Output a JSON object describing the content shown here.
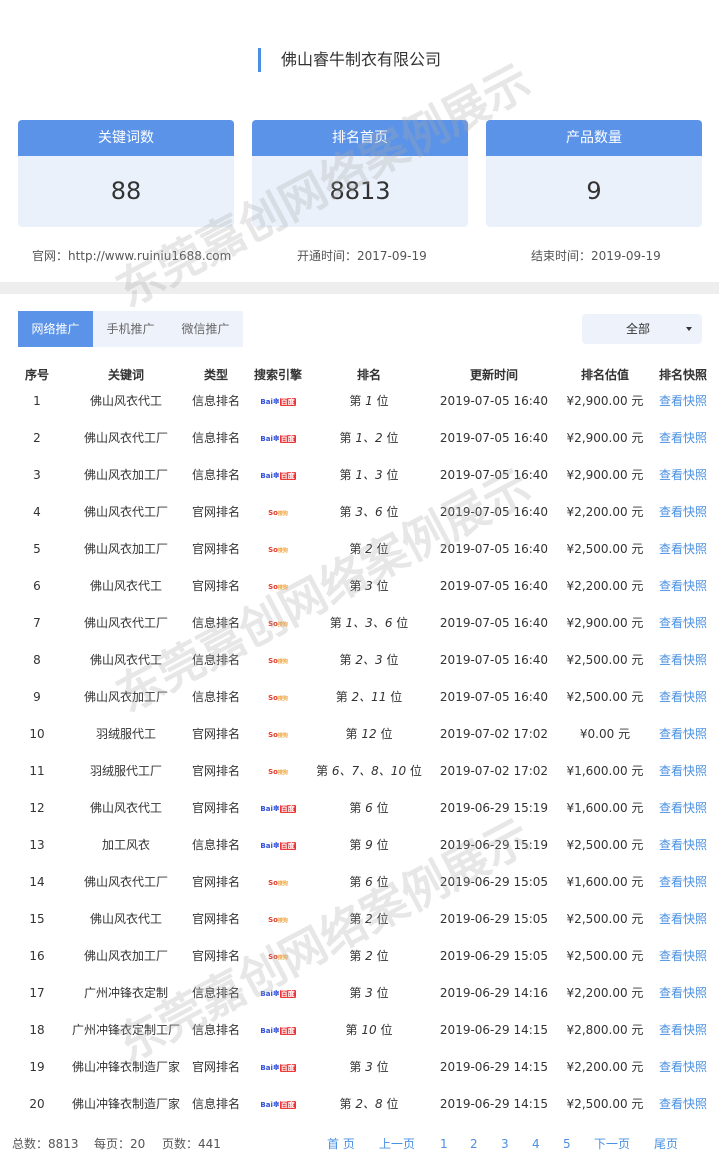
{
  "company": "佛山睿牛制衣有限公司",
  "stats": [
    {
      "label": "关键词数",
      "value": "88"
    },
    {
      "label": "排名首页",
      "value": "8813"
    },
    {
      "label": "产品数量",
      "value": "9"
    }
  ],
  "site_info": {
    "website": "官网：http://www.ruiniu1688.com",
    "open_time": "开通时间：2017-09-19",
    "end_time": "结束时间：2019-09-19"
  },
  "tabs": [
    {
      "label": "网络推广",
      "active": true
    },
    {
      "label": "手机推广",
      "active": false
    },
    {
      "label": "微信推广",
      "active": false
    }
  ],
  "filter": {
    "value": "全部"
  },
  "table": {
    "headers": [
      "序号",
      "关键词",
      "类型",
      "搜索引擎",
      "排名",
      "更新时间",
      "排名估值",
      "排名快照"
    ],
    "rows": [
      {
        "no": "1",
        "keyword": "佛山风衣代工",
        "type": "信息排名",
        "engine": "baidu",
        "rank_pre": "第 ",
        "rank_num": "1",
        "rank_post": " 位",
        "time": "2019-07-05 16:40",
        "value": "¥2,900.00 元",
        "snap": "查看快照"
      },
      {
        "no": "2",
        "keyword": "佛山风衣代工厂",
        "type": "信息排名",
        "engine": "baidu",
        "rank_pre": "第 ",
        "rank_num": "1、2",
        "rank_post": " 位",
        "time": "2019-07-05 16:40",
        "value": "¥2,900.00 元",
        "snap": "查看快照"
      },
      {
        "no": "3",
        "keyword": "佛山风衣加工厂",
        "type": "信息排名",
        "engine": "baidu",
        "rank_pre": "第 ",
        "rank_num": "1、3",
        "rank_post": " 位",
        "time": "2019-07-05 16:40",
        "value": "¥2,900.00 元",
        "snap": "查看快照"
      },
      {
        "no": "4",
        "keyword": "佛山风衣代工厂",
        "type": "官网排名",
        "engine": "so",
        "rank_pre": "第 ",
        "rank_num": "3、6",
        "rank_post": " 位",
        "time": "2019-07-05 16:40",
        "value": "¥2,200.00 元",
        "snap": "查看快照"
      },
      {
        "no": "5",
        "keyword": "佛山风衣加工厂",
        "type": "官网排名",
        "engine": "so",
        "rank_pre": "第 ",
        "rank_num": "2",
        "rank_post": " 位",
        "time": "2019-07-05 16:40",
        "value": "¥2,500.00 元",
        "snap": "查看快照"
      },
      {
        "no": "6",
        "keyword": "佛山风衣代工",
        "type": "官网排名",
        "engine": "so",
        "rank_pre": "第 ",
        "rank_num": "3",
        "rank_post": " 位",
        "time": "2019-07-05 16:40",
        "value": "¥2,200.00 元",
        "snap": "查看快照"
      },
      {
        "no": "7",
        "keyword": "佛山风衣代工厂",
        "type": "信息排名",
        "engine": "so",
        "rank_pre": "第 ",
        "rank_num": "1、3、6",
        "rank_post": " 位",
        "time": "2019-07-05 16:40",
        "value": "¥2,900.00 元",
        "snap": "查看快照"
      },
      {
        "no": "8",
        "keyword": "佛山风衣代工",
        "type": "信息排名",
        "engine": "so",
        "rank_pre": "第 ",
        "rank_num": "2、3",
        "rank_post": " 位",
        "time": "2019-07-05 16:40",
        "value": "¥2,500.00 元",
        "snap": "查看快照"
      },
      {
        "no": "9",
        "keyword": "佛山风衣加工厂",
        "type": "信息排名",
        "engine": "so",
        "rank_pre": "第 ",
        "rank_num": "2、11",
        "rank_post": " 位",
        "time": "2019-07-05 16:40",
        "value": "¥2,500.00 元",
        "snap": "查看快照"
      },
      {
        "no": "10",
        "keyword": "羽绒服代工",
        "type": "官网排名",
        "engine": "so",
        "rank_pre": "第 ",
        "rank_num": "12",
        "rank_post": " 位",
        "time": "2019-07-02 17:02",
        "value": "¥0.00 元",
        "snap": "查看快照"
      },
      {
        "no": "11",
        "keyword": "羽绒服代工厂",
        "type": "官网排名",
        "engine": "so",
        "rank_pre": "第 ",
        "rank_num": "6、7、8、10",
        "rank_post": " 位",
        "time": "2019-07-02 17:02",
        "value": "¥1,600.00 元",
        "snap": "查看快照"
      },
      {
        "no": "12",
        "keyword": "佛山风衣代工",
        "type": "官网排名",
        "engine": "baidu",
        "rank_pre": "第 ",
        "rank_num": "6",
        "rank_post": " 位",
        "time": "2019-06-29 15:19",
        "value": "¥1,600.00 元",
        "snap": "查看快照"
      },
      {
        "no": "13",
        "keyword": "加工风衣",
        "type": "信息排名",
        "engine": "baidu",
        "rank_pre": "第 ",
        "rank_num": "9",
        "rank_post": " 位",
        "time": "2019-06-29 15:19",
        "value": "¥2,500.00 元",
        "snap": "查看快照"
      },
      {
        "no": "14",
        "keyword": "佛山风衣代工厂",
        "type": "官网排名",
        "engine": "so",
        "rank_pre": "第 ",
        "rank_num": "6",
        "rank_post": " 位",
        "time": "2019-06-29 15:05",
        "value": "¥1,600.00 元",
        "snap": "查看快照"
      },
      {
        "no": "15",
        "keyword": "佛山风衣代工",
        "type": "官网排名",
        "engine": "so",
        "rank_pre": "第 ",
        "rank_num": "2",
        "rank_post": " 位",
        "time": "2019-06-29 15:05",
        "value": "¥2,500.00 元",
        "snap": "查看快照"
      },
      {
        "no": "16",
        "keyword": "佛山风衣加工厂",
        "type": "官网排名",
        "engine": "so",
        "rank_pre": "第 ",
        "rank_num": "2",
        "rank_post": " 位",
        "time": "2019-06-29 15:05",
        "value": "¥2,500.00 元",
        "snap": "查看快照"
      },
      {
        "no": "17",
        "keyword": "广州冲锋衣定制",
        "type": "信息排名",
        "engine": "baidu",
        "rank_pre": "第 ",
        "rank_num": "3",
        "rank_post": " 位",
        "time": "2019-06-29 14:16",
        "value": "¥2,200.00 元",
        "snap": "查看快照"
      },
      {
        "no": "18",
        "keyword": "广州冲锋衣定制工厂",
        "type": "信息排名",
        "engine": "baidu",
        "rank_pre": "第 ",
        "rank_num": "10",
        "rank_post": " 位",
        "time": "2019-06-29 14:15",
        "value": "¥2,800.00 元",
        "snap": "查看快照"
      },
      {
        "no": "19",
        "keyword": "佛山冲锋衣制造厂家",
        "type": "官网排名",
        "engine": "baidu",
        "rank_pre": "第 ",
        "rank_num": "3",
        "rank_post": " 位",
        "time": "2019-06-29 14:15",
        "value": "¥2,200.00 元",
        "snap": "查看快照"
      },
      {
        "no": "20",
        "keyword": "佛山冲锋衣制造厂家",
        "type": "信息排名",
        "engine": "baidu",
        "rank_pre": "第 ",
        "rank_num": "2、8",
        "rank_post": " 位",
        "time": "2019-06-29 14:15",
        "value": "¥2,500.00 元",
        "snap": "查看快照"
      }
    ]
  },
  "engines": {
    "baidu": {
      "text1": "Bai",
      "paw": "✽",
      "text2": "百度",
      "icon": "baidu-logo-icon"
    },
    "so": {
      "text1": "So",
      "paw": "",
      "text2": "搜狗",
      "icon": "sogou-logo-icon"
    }
  },
  "pagination": {
    "total": "总数：8813",
    "per_page": "每页：20",
    "pages": "页数：441",
    "first": "首 页",
    "prev": "上一页",
    "page_numbers": [
      "1",
      "2",
      "3",
      "4",
      "5"
    ],
    "next": "下一页",
    "last": "尾页"
  },
  "watermark": "东莞嘉创网络案例展示",
  "colors": {
    "accent": "#5b93e8",
    "link": "#4a90e2",
    "panel": "#eaf1fb"
  }
}
